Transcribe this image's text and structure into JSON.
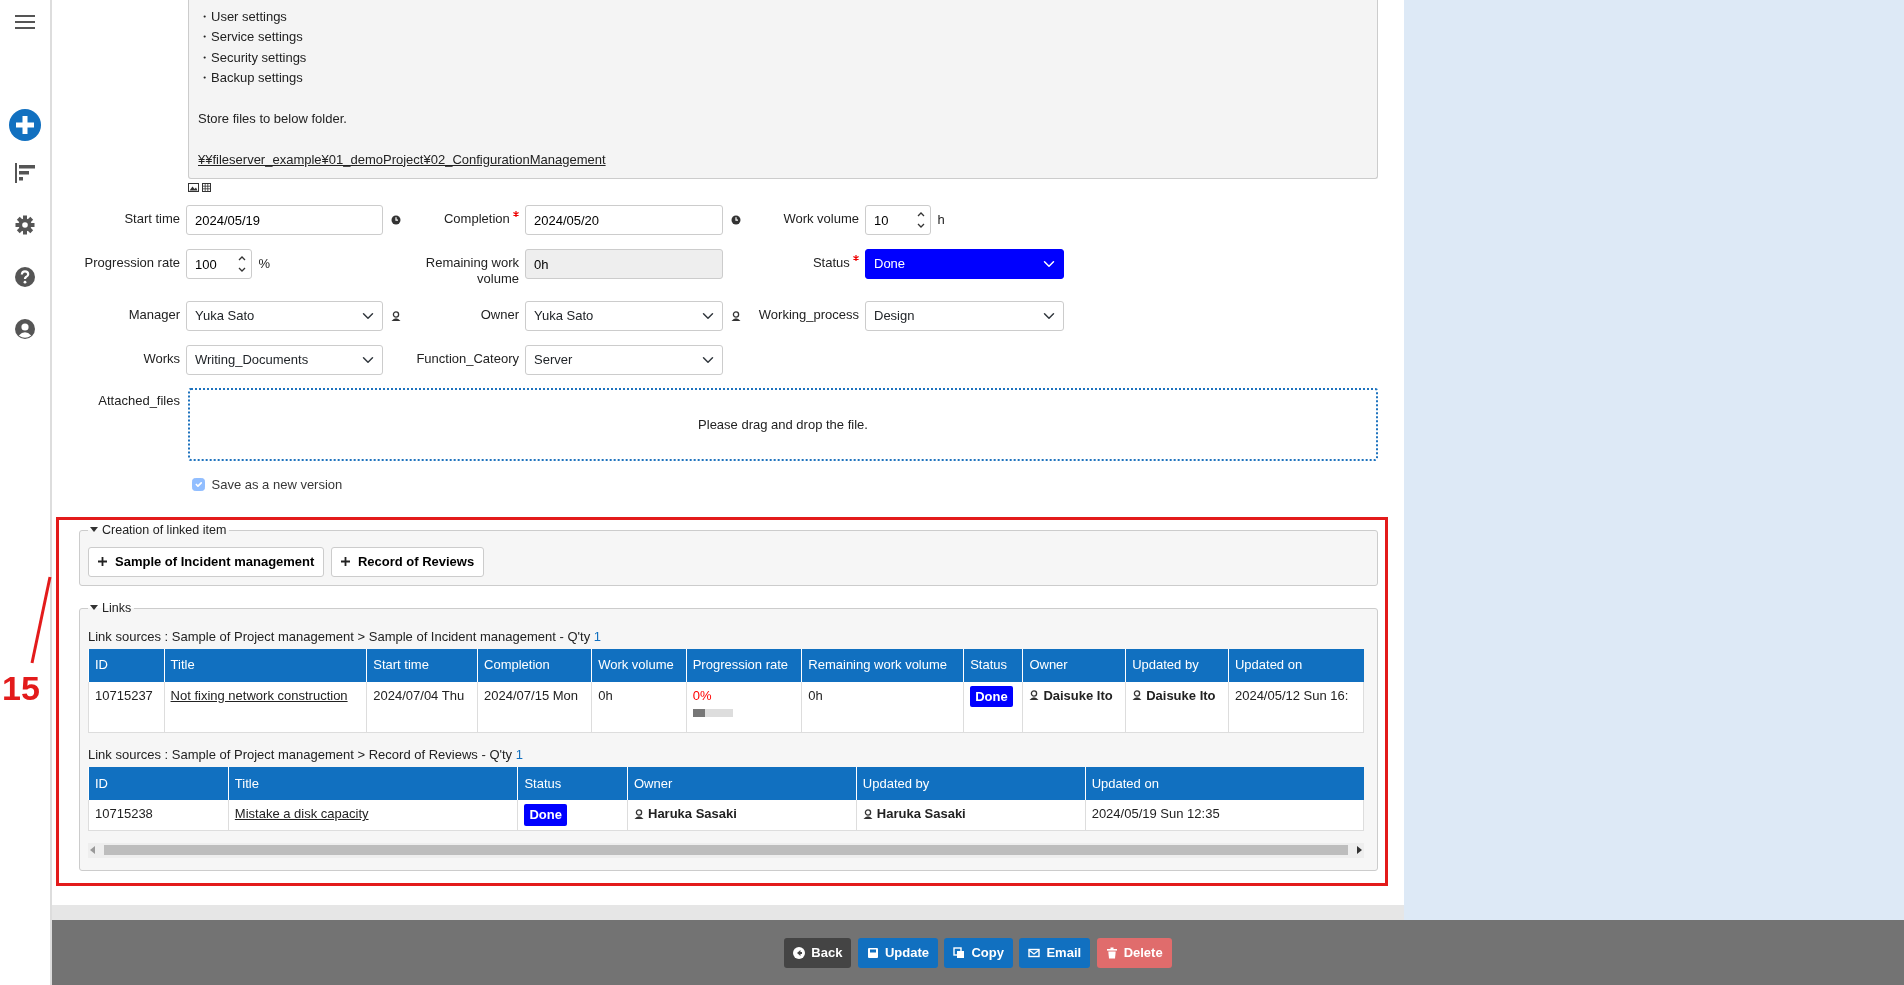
{
  "description": {
    "bullets": [
      "・User settings",
      "・Service settings",
      "・Security settings",
      "・Backup settings"
    ],
    "note": "Store files to below folder.",
    "link": "¥¥fileserver_example¥01_demoProject¥02_ConfigurationManagement"
  },
  "form": {
    "rows": [
      [
        {
          "kind": "date",
          "label": "Start time",
          "required": false,
          "value": "2024/05/19"
        },
        {
          "kind": "date",
          "label": "Completion",
          "required": true,
          "value": "2024/05/20"
        },
        {
          "kind": "number",
          "label": "Work volume",
          "required": false,
          "value": "10",
          "unit": "h"
        }
      ],
      [
        {
          "kind": "number",
          "label": "Progression rate",
          "required": false,
          "value": "100",
          "unit": "%"
        },
        {
          "kind": "readonly",
          "label": "Remaining work volume",
          "required": false,
          "value": "0h"
        },
        {
          "kind": "status",
          "label": "Status",
          "required": true,
          "value": "Done"
        }
      ],
      [
        {
          "kind": "user",
          "label": "Manager",
          "required": false,
          "value": "Yuka Sato"
        },
        {
          "kind": "user",
          "label": "Owner",
          "required": false,
          "value": "Yuka Sato"
        },
        {
          "kind": "select",
          "label": "Working_process",
          "required": false,
          "value": "Design"
        }
      ],
      [
        {
          "kind": "select",
          "label": "Works",
          "required": false,
          "value": "Writing_Documents"
        },
        {
          "kind": "select",
          "label": "Function_Cateory",
          "required": false,
          "value": "Server"
        }
      ]
    ],
    "attachments": {
      "label": "Attached_files",
      "hint": "Please drag and drop the file."
    },
    "save_version": {
      "label": "Save as a new version",
      "checked": true,
      "disabled": true
    }
  },
  "linked_creation": {
    "title": "Creation of linked item",
    "expanded": true,
    "buttons": [
      "Sample of Incident management",
      "Record of Reviews"
    ]
  },
  "links": {
    "title": "Links",
    "expanded": true,
    "tables": [
      {
        "caption": "Link sources : Sample of Project management > Sample of Incident management - Q'ty",
        "count": "1",
        "columns": [
          "ID",
          "Title",
          "Start time",
          "Completion",
          "Work volume",
          "Progression rate",
          "Remaining work volume",
          "Status",
          "Owner",
          "Updated by",
          "Updated on"
        ],
        "rows": [
          [
            {
              "kind": "text",
              "text": "10715237"
            },
            {
              "kind": "link",
              "text": "Not fixing network construction"
            },
            {
              "kind": "text",
              "text": "2024/07/04 Thu"
            },
            {
              "kind": "text",
              "text": "2024/07/15 Mon"
            },
            {
              "kind": "text",
              "text": "0h"
            },
            {
              "kind": "progress",
              "text": "0%",
              "level": 0.3
            },
            {
              "kind": "text",
              "text": "0h"
            },
            {
              "kind": "status",
              "text": "Done"
            },
            {
              "kind": "user",
              "text": "Daisuke Ito"
            },
            {
              "kind": "user",
              "text": "Daisuke Ito"
            },
            {
              "kind": "text",
              "text": "2024/05/12 Sun 16:"
            }
          ]
        ]
      },
      {
        "caption": "Link sources : Sample of Project management > Record of Reviews - Q'ty",
        "count": "1",
        "columns": [
          "ID",
          "Title",
          "Status",
          "Owner",
          "Updated by",
          "Updated on"
        ],
        "rows": [
          [
            {
              "kind": "text",
              "text": "10715238"
            },
            {
              "kind": "link",
              "text": "Mistake a disk capacity"
            },
            {
              "kind": "status",
              "text": "Done"
            },
            {
              "kind": "user",
              "text": "Haruka Sasaki"
            },
            {
              "kind": "user",
              "text": "Haruka Sasaki"
            },
            {
              "kind": "text",
              "text": "2024/05/19 Sun 12:35"
            }
          ]
        ]
      }
    ]
  },
  "callout": {
    "number": "15"
  },
  "footer": {
    "buttons": [
      {
        "kind": "back",
        "label": "Back"
      },
      {
        "kind": "update",
        "label": "Update"
      },
      {
        "kind": "copy",
        "label": "Copy"
      },
      {
        "kind": "email",
        "label": "Email"
      },
      {
        "kind": "delete",
        "label": "Delete"
      }
    ]
  }
}
